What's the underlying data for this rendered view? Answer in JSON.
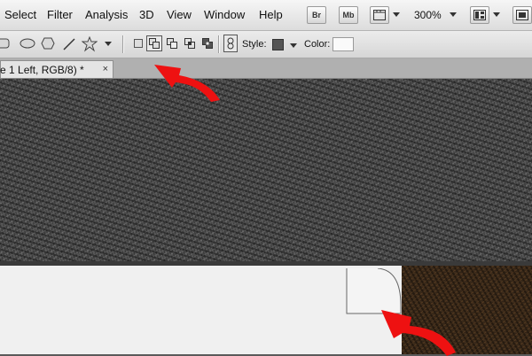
{
  "menu": {
    "items": [
      "Select",
      "Filter",
      "Analysis",
      "3D",
      "View",
      "Window",
      "Help"
    ]
  },
  "app_toolbar": {
    "bridge_label": "Br",
    "minibridge_label": "Mb",
    "zoom": "300%"
  },
  "options_bar": {
    "style_label": "Style:",
    "color_label": "Color:",
    "style_swatch_color": "#555555",
    "color_swatch_color": "#fafafa"
  },
  "document": {
    "tab_title": "e 1 Left, RGB/8) *",
    "tab_close": "×"
  },
  "colors": {
    "annotation_arrow": "#ee1111",
    "wall": "#f0f0f0",
    "wood": "#3e2c1b",
    "stone": "#4a4a4a"
  }
}
